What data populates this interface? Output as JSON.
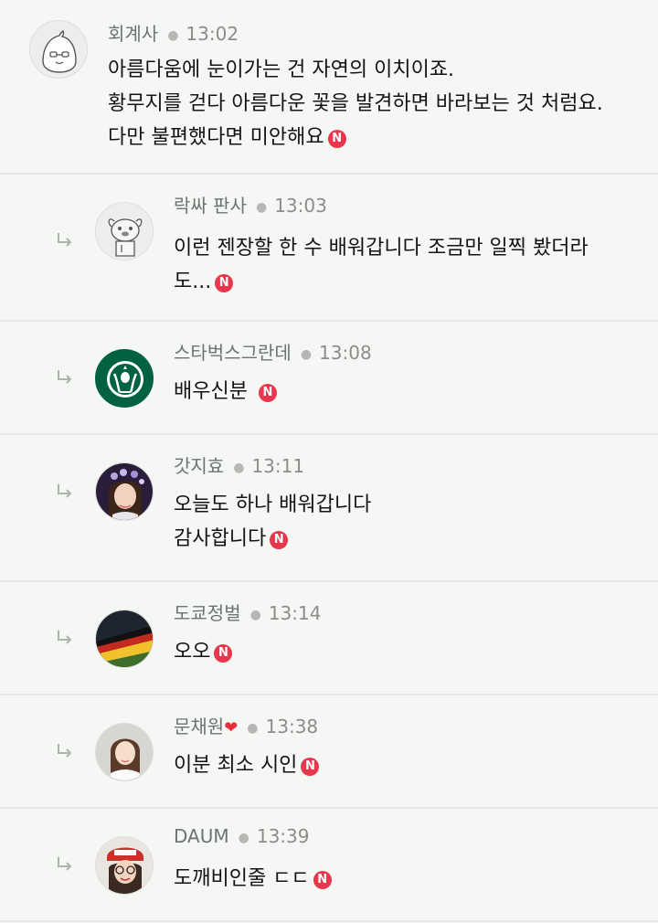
{
  "comments": [
    {
      "author": "회계사",
      "time": "13:02",
      "lines": [
        "아름다움에 눈이가는 건 자연의 이치이죠.",
        "황무지를 걷다 아름다운 꽃을 발견하면 바라보는 것 처럼요.",
        "다만 불편했다면 미안해요"
      ],
      "avatar_icon": "apeach-avatar-icon"
    },
    {
      "author": "락싸 판사",
      "time": "13:03",
      "lines": [
        "이런 젠장할 한 수 배워갑니다 조금만 일찍 봤더라",
        "도..."
      ],
      "avatar_icon": "muzi-avatar-icon"
    },
    {
      "author": "스타벅스그란데",
      "time": "13:08",
      "lines": [
        "배우신분"
      ],
      "avatar_icon": "starbucks-logo-avatar"
    },
    {
      "author": "갓지효",
      "time": "13:11",
      "lines": [
        "오늘도 하나 배워갑니다",
        "감사합니다"
      ],
      "avatar_icon": "person-photo-avatar"
    },
    {
      "author": "도쿄정벌",
      "time": "13:14",
      "lines": [
        "오오"
      ],
      "avatar_icon": "flag-photo-avatar"
    },
    {
      "author": "문채원",
      "time": "13:38",
      "lines": [
        "이분 최소 시인"
      ],
      "avatar_icon": "person-photo-avatar"
    },
    {
      "author": "DAUM",
      "time": "13:39",
      "lines": [
        "도깨비인줄 ㄷㄷ"
      ],
      "avatar_icon": "person-photo-avatar"
    }
  ],
  "badge_letter": "N",
  "colors": {
    "badge": "#e8364c",
    "background": "#f5f7f4",
    "divider": "#e4e7e3",
    "meta": "#6f7370"
  }
}
